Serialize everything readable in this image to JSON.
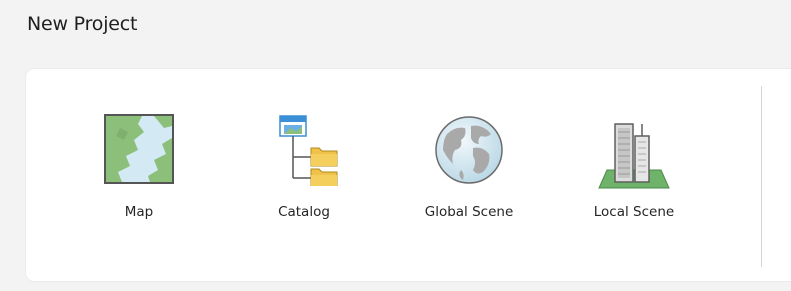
{
  "section": {
    "title": "New Project"
  },
  "templates": [
    {
      "label": "Map",
      "icon": "map-icon"
    },
    {
      "label": "Catalog",
      "icon": "catalog-icon"
    },
    {
      "label": "Global Scene",
      "icon": "globe-icon"
    },
    {
      "label": "Local Scene",
      "icon": "buildings-icon"
    }
  ],
  "colors": {
    "map_land": "#8cbf7a",
    "map_water": "#d3eaf5",
    "folder": "#f0c24a",
    "window_blue": "#3b8fd6",
    "scene_ground": "#6fb36a"
  }
}
